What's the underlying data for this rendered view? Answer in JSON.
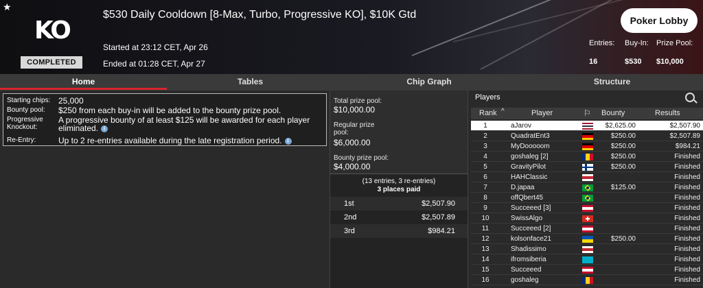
{
  "header": {
    "logo_text": "KO",
    "status_badge": "COMPLETED",
    "title": "$530 Daily Cooldown [8-Max, Turbo, Progressive KO], $10K Gtd",
    "started": "Started at 23:12 CET, Apr 26",
    "ended": "Ended at 01:28 CET, Apr 27",
    "lobby_button": "Poker Lobby",
    "stats": {
      "entries_label": "Entries:",
      "entries_value": "16",
      "buyin_label": "Buy-In:",
      "buyin_value": "$530",
      "prize_label": "Prize Pool:",
      "prize_value": "$10,000"
    }
  },
  "tabs": [
    "Home",
    "Tables",
    "Chip Graph",
    "Structure"
  ],
  "info": {
    "starting_chips_label": "Starting chips:",
    "starting_chips_value": "25,000",
    "bounty_pool_label": "Bounty pool:",
    "bounty_pool_value": "$250 from each buy-in will be added to the bounty prize pool.",
    "progressive_label": "Progressive Knockout:",
    "progressive_value": "A progressive bounty of at least $125 will be awarded for each player eliminated.",
    "reentry_label": "Re-Entry:",
    "reentry_value": "Up to 2 re-entries available during the late registration period."
  },
  "prize": {
    "total_label": "Total prize pool:",
    "total_value": "$10,000.00",
    "regular_label": "Regular prize pool:",
    "regular_value": "$6,000.00",
    "bounty_label": "Bounty prize pool:",
    "bounty_value": "$4,000.00",
    "entries_note": "(13 entries, 3 re-entries)",
    "places_paid": "3 places paid",
    "payouts": [
      {
        "place": "1st",
        "amount": "$2,507.90"
      },
      {
        "place": "2nd",
        "amount": "$2,507.89"
      },
      {
        "place": "3rd",
        "amount": "$984.21"
      }
    ]
  },
  "players_panel": {
    "title": "Players",
    "columns": {
      "rank": "Rank",
      "player": "Player",
      "bounty": "Bounty",
      "results": "Results"
    },
    "rows": [
      {
        "rank": "1",
        "name": "aJarov",
        "flag": [
          "#a51931",
          "#ffffff",
          "#2d2a4a",
          "#ffffff",
          "#a51931"
        ],
        "bounty": "$2,625.00",
        "result": "$2,507.90"
      },
      {
        "rank": "2",
        "name": "QuadratEnt3",
        "flag": [
          "#000000",
          "#dd0000",
          "#ffce00"
        ],
        "bounty": "$250.00",
        "result": "$2,507.89"
      },
      {
        "rank": "3",
        "name": "MyDooooom",
        "flag": [
          "#000000",
          "#dd0000",
          "#ffce00"
        ],
        "bounty": "$250.00",
        "result": "$984.21"
      },
      {
        "rank": "4",
        "name": "goshaleg [2]",
        "flag": [
          "v",
          "#002b7f",
          "#fcd116",
          "#ce1126"
        ],
        "bounty": "$250.00",
        "result": "Finished"
      },
      {
        "rank": "5",
        "name": "GravityPilot",
        "flag": [
          "fi"
        ],
        "bounty": "$250.00",
        "result": "Finished"
      },
      {
        "rank": "6",
        "name": "HAHClassic",
        "flag": [
          "#ffffff",
          "#c1272d",
          "#ffffff"
        ],
        "bounty": "",
        "result": "Finished"
      },
      {
        "rank": "7",
        "name": "D.japaa",
        "flag": [
          "br"
        ],
        "bounty": "$125.00",
        "result": "Finished"
      },
      {
        "rank": "8",
        "name": "offQbert45",
        "flag": [
          "br"
        ],
        "bounty": "",
        "result": "Finished"
      },
      {
        "rank": "9",
        "name": "Succeeed [3]",
        "flag": [
          "#c8102e",
          "#ffffff",
          "#c8102e"
        ],
        "bounty": "",
        "result": "Finished"
      },
      {
        "rank": "10",
        "name": "SwissAlgo",
        "flag": [
          "ch"
        ],
        "bounty": "",
        "result": "Finished"
      },
      {
        "rank": "11",
        "name": "Succeeed [2]",
        "flag": [
          "#c8102e",
          "#ffffff",
          "#c8102e"
        ],
        "bounty": "",
        "result": "Finished"
      },
      {
        "rank": "12",
        "name": "kolsonface21",
        "flag": [
          "#0057b7",
          "#ffd700"
        ],
        "bounty": "$250.00",
        "result": "Finished"
      },
      {
        "rank": "13",
        "name": "Shadissimo",
        "flag": [
          "#ffffff",
          "#c1272d",
          "#ffffff"
        ],
        "bounty": "",
        "result": "Finished"
      },
      {
        "rank": "14",
        "name": "ifromsiberia",
        "flag": [
          "#00afca"
        ],
        "bounty": "",
        "result": "Finished"
      },
      {
        "rank": "15",
        "name": "Succeeed",
        "flag": [
          "#c8102e",
          "#ffffff",
          "#c8102e"
        ],
        "bounty": "",
        "result": "Finished"
      },
      {
        "rank": "16",
        "name": "goshaleg",
        "flag": [
          "v",
          "#002b7f",
          "#fcd116",
          "#ce1126"
        ],
        "bounty": "",
        "result": "Finished"
      }
    ]
  },
  "colors": {
    "accent": "#d8252b",
    "info_icon": "#7aa9d8"
  }
}
